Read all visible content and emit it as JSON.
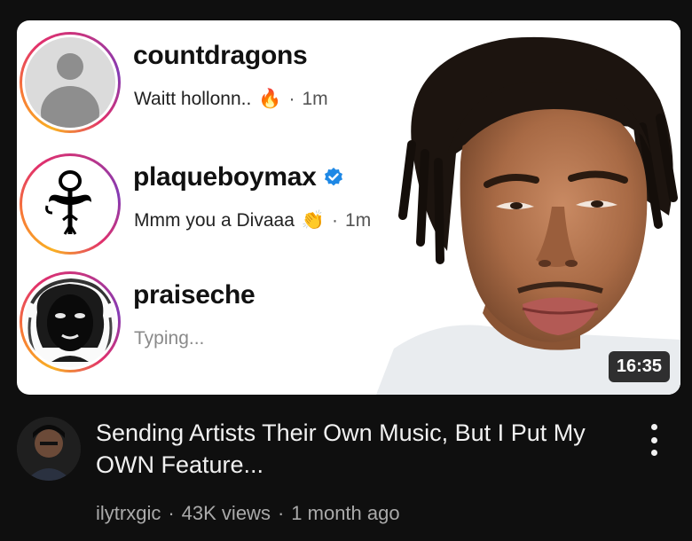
{
  "thumbnail": {
    "dms": [
      {
        "username": "countdragons",
        "message": "Waitt hollonn..",
        "emoji": "🔥",
        "time": "1m",
        "verified": false,
        "avatar": "default-avatar-icon"
      },
      {
        "username": "plaqueboymax",
        "message": "Mmm you a Divaaa",
        "emoji": "👏",
        "time": "1m",
        "verified": true,
        "avatar": "love-symbol-icon"
      },
      {
        "username": "praiseche",
        "message": "Typing...",
        "emoji": "",
        "time": "",
        "verified": false,
        "avatar": "portrait-avatar"
      }
    ],
    "time_separator": "·",
    "duration": "16:35"
  },
  "video": {
    "title": "Sending Artists Their Own Music, But I Put My OWN Feature...",
    "channel": "ilytrxgic",
    "views": "43K views",
    "age": "1 month ago",
    "separator": "·"
  },
  "colors": {
    "background": "#0f0f0f",
    "title_text": "#f1f1f1",
    "secondary_text": "#aaaaaa",
    "verified_blue": "#1e88e5",
    "story_ring_start": "#f9b023",
    "story_ring_end": "#c13584"
  },
  "icons": {
    "menu": "more-vert-icon",
    "verified": "verified-badge-icon"
  }
}
